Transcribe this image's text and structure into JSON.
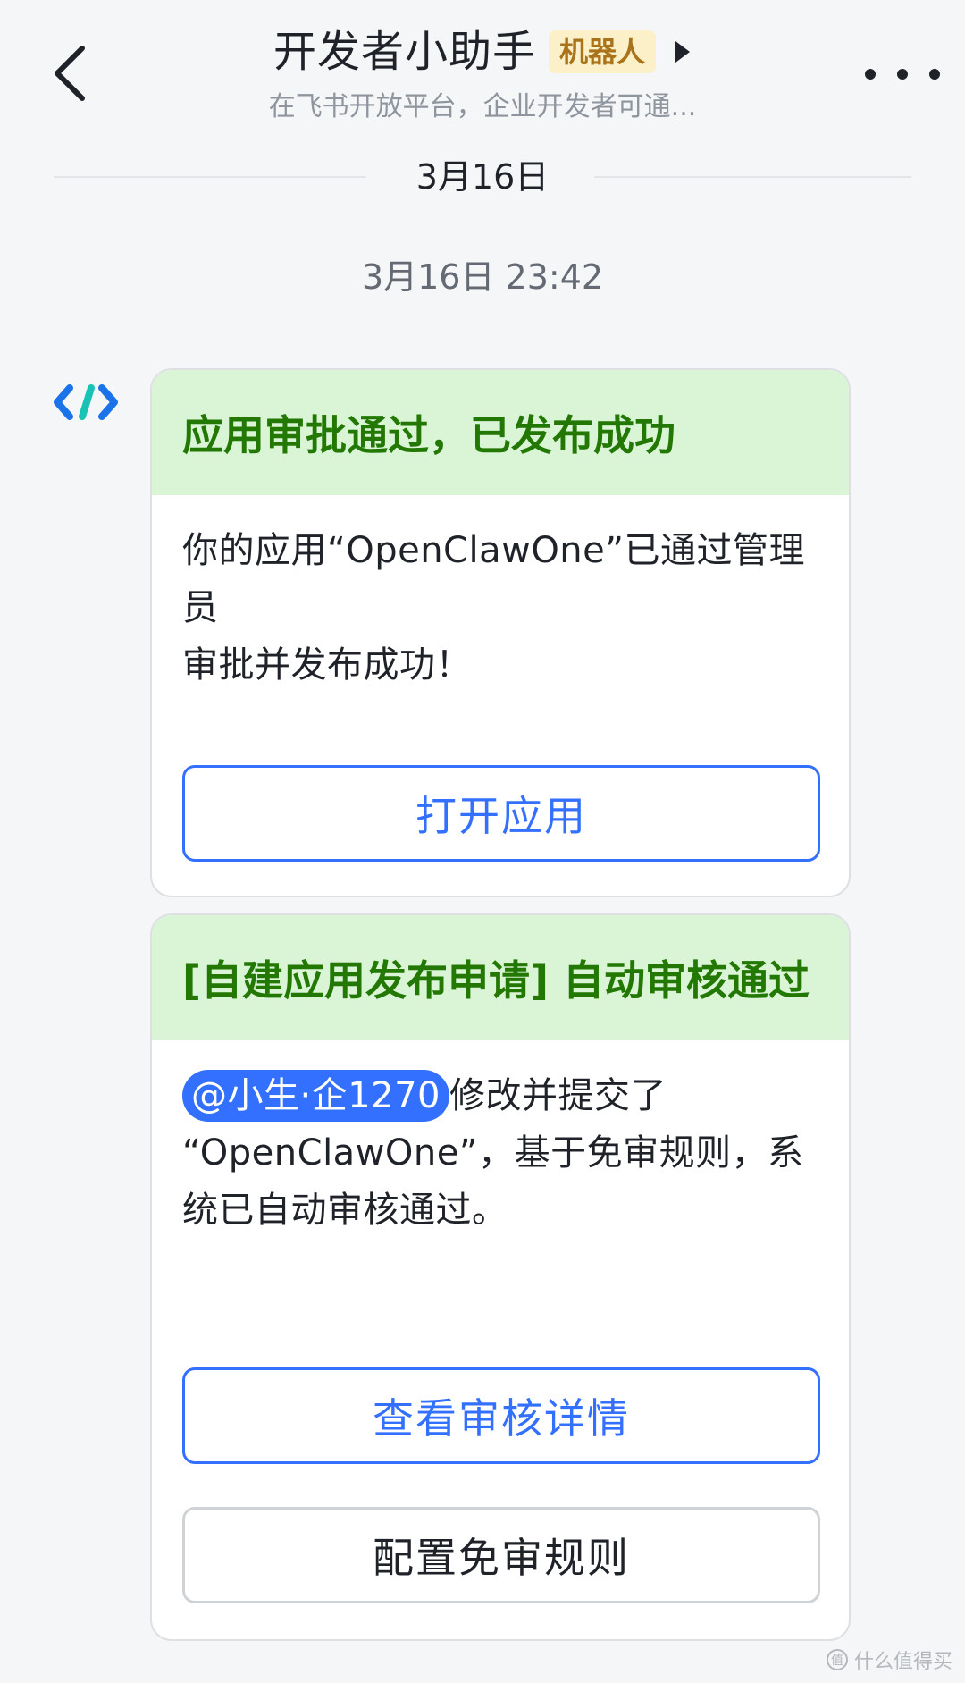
{
  "header": {
    "title": "开发者小助手",
    "bot_badge": "机器人",
    "subtitle": "在飞书开放平台，企业开发者可通..."
  },
  "icons": {
    "back": "chevron-left-icon",
    "expand": "caret-right-icon",
    "more": "more-dots-icon",
    "avatar": "developer-assistant-logo-icon"
  },
  "colors": {
    "accent": "#3370ff",
    "card_header_bg": "#d9f5d6",
    "card_header_text": "#237804",
    "bot_badge_bg": "#fcf0c8",
    "bot_badge_text": "#a8731b"
  },
  "chat": {
    "date_divider": "3月16日",
    "timestamp": "3月16日 23:42",
    "cards": [
      {
        "title": "应用审批通过，已发布成功",
        "body_line1": "你的应用“OpenClawOne”已通过管理员",
        "body_line2": "审批并发布成功！",
        "buttons": [
          {
            "label": "打开应用"
          }
        ]
      },
      {
        "title": "[自建应用发布申请] 自动审核通过",
        "mention": "@小生·企1270",
        "body_after_mention": "修改并提交了",
        "body_line2": "“OpenClawOne”，基于免审规则，系",
        "body_line3": "统已自动审核通过。",
        "buttons": [
          {
            "label": "查看审核详情"
          },
          {
            "label": "配置免审规则"
          }
        ]
      }
    ]
  },
  "watermark": {
    "text": "什么值得买"
  }
}
